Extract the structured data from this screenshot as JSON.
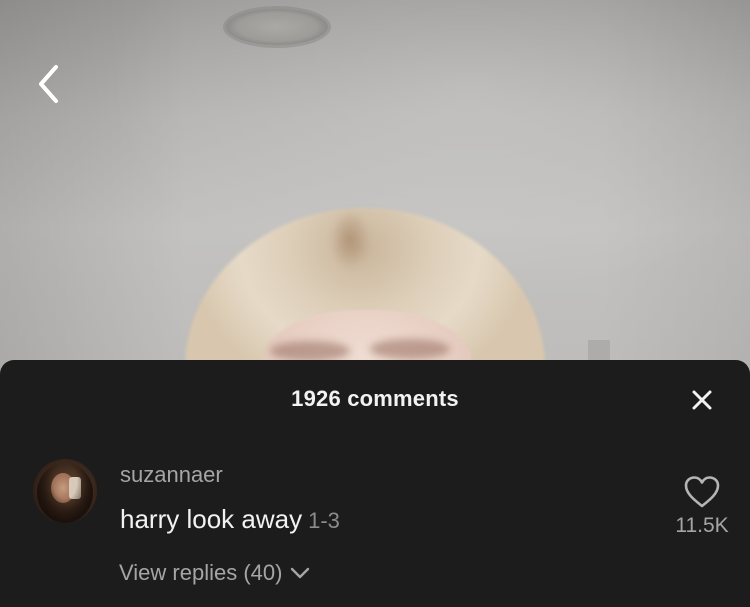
{
  "header": {
    "comments_title": "1926 comments"
  },
  "icons": {
    "back": "chevron-left-icon",
    "close": "close-icon",
    "like": "heart-outline-icon",
    "expand": "chevron-down-icon"
  },
  "comment": {
    "username": "suzannaer",
    "text": "harry look away",
    "timestamp": "1-3",
    "like_count": "11.5K",
    "view_replies_label": "View replies (40)"
  },
  "colors": {
    "sheet_background": "#1c1c1c",
    "primary_text": "#f2f2f2",
    "secondary_text": "#a5a5a5"
  }
}
